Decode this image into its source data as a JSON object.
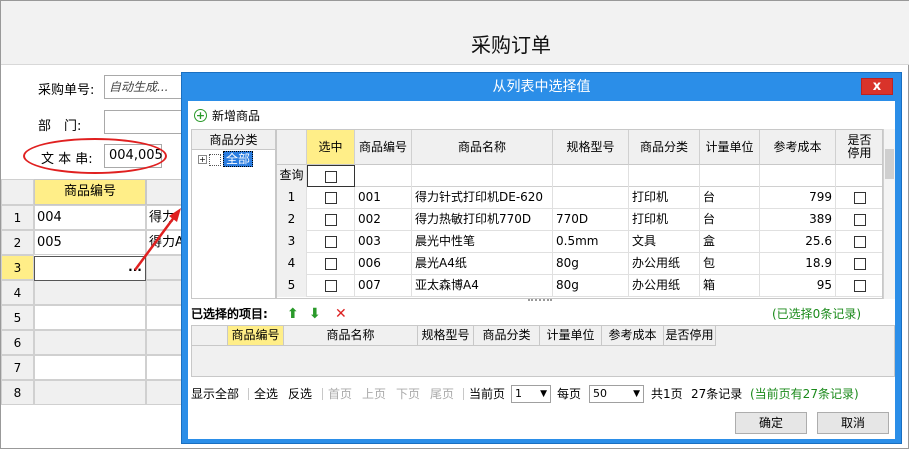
{
  "form": {
    "title": "采购订单",
    "order_no_label": "采购单号:",
    "order_no_value": "自动生成...",
    "dept_label": "部　门:",
    "dept_value": "",
    "text_label": "文 本 串:",
    "text_value": "004,005"
  },
  "grid": {
    "header": "商品编号",
    "rows": [
      {
        "num": "1",
        "code": "004",
        "name": "得力"
      },
      {
        "num": "2",
        "code": "005",
        "name": "得力A"
      },
      {
        "num": "3",
        "code": "",
        "name": ""
      },
      {
        "num": "4",
        "code": "",
        "name": ""
      },
      {
        "num": "5",
        "code": "",
        "name": ""
      },
      {
        "num": "6",
        "code": "",
        "name": ""
      },
      {
        "num": "7",
        "code": "",
        "name": ""
      },
      {
        "num": "8",
        "code": "",
        "name": ""
      }
    ],
    "editor_button": "..."
  },
  "dialog": {
    "title": "从列表中选择值",
    "close": "x",
    "add_label": "新增商品",
    "category_header": "商品分类",
    "category_root": "全部",
    "query_label": "查询",
    "columns": [
      "选中",
      "商品编号",
      "商品名称",
      "规格型号",
      "商品分类",
      "计量单位",
      "参考成本",
      "是否停用"
    ],
    "rows": [
      {
        "num": "1",
        "code": "001",
        "name": "得力针式打印机DE-620",
        "spec": "",
        "cat": "打印机",
        "unit": "台",
        "cost": "799"
      },
      {
        "num": "2",
        "code": "002",
        "name": "得力热敏打印机770D",
        "spec": "770D",
        "cat": "打印机",
        "unit": "台",
        "cost": "389"
      },
      {
        "num": "3",
        "code": "003",
        "name": "晨光中性笔",
        "spec": "0.5mm",
        "cat": "文具",
        "unit": "盒",
        "cost": "25.6"
      },
      {
        "num": "4",
        "code": "006",
        "name": "晨光A4纸",
        "spec": "80g",
        "cat": "办公用纸",
        "unit": "包",
        "cost": "18.9"
      },
      {
        "num": "5",
        "code": "007",
        "name": "亚太森博A4",
        "spec": "80g",
        "cat": "办公用纸",
        "unit": "箱",
        "cost": "95"
      }
    ],
    "selected_label": "已选择的项目:",
    "selected_count": "(已选择0条记录)",
    "selected_columns": [
      "商品编号",
      "商品名称",
      "规格型号",
      "商品分类",
      "计量单位",
      "参考成本",
      "是否停用"
    ],
    "pager": {
      "show_all": "显示全部",
      "select_all": "全选",
      "invert": "反选",
      "first": "首页",
      "prev": "上页",
      "next": "下页",
      "last": "尾页",
      "current_label": "当前页",
      "current_value": "1",
      "per_page_label": "每页",
      "per_page_value": "50",
      "total_pages": "共1页",
      "total_records": "27条记录",
      "page_records": "(当前页有27条记录)"
    },
    "ok": "确定",
    "cancel": "取消"
  },
  "colors": {
    "dialog_blue": "#2b8ee8",
    "header_yellow": "#ffee88",
    "close_red": "#d9332a",
    "annotation_red": "#e02020"
  }
}
